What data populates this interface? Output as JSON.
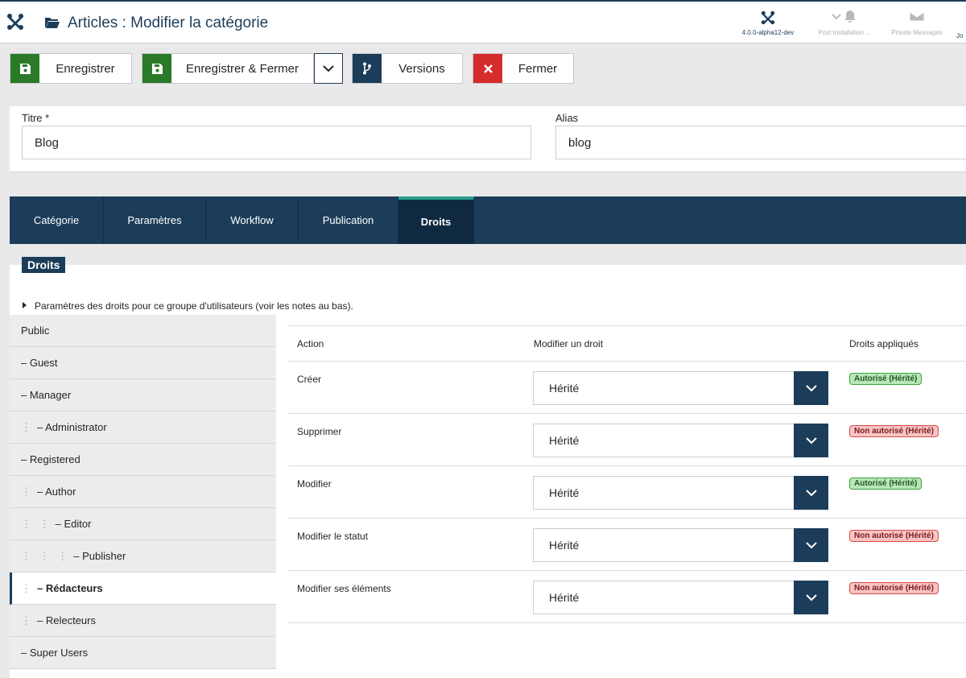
{
  "header": {
    "title": "Articles : Modifier la catégorie",
    "version": "4.0.0-alpha12-dev",
    "post_install": "Post Installation ...",
    "private_messages": "Private Messages",
    "user_initials": "Jo"
  },
  "toolbar": {
    "save": "Enregistrer",
    "save_close": "Enregistrer & Fermer",
    "versions": "Versions",
    "close": "Fermer"
  },
  "form": {
    "title_label": "Titre *",
    "title_value": "Blog",
    "alias_label": "Alias",
    "alias_value": "blog"
  },
  "tabs": [
    "Catégorie",
    "Paramètres",
    "Workflow",
    "Publication",
    "Droits"
  ],
  "active_tab": "Droits",
  "section": {
    "badge": "Droits",
    "summary": "Paramètres des droits pour ce groupe d'utilisateurs (voir les notes au bas)."
  },
  "groups": [
    {
      "dots": "",
      "label": "Public"
    },
    {
      "dots": "",
      "label": "– Guest"
    },
    {
      "dots": "",
      "label": "– Manager"
    },
    {
      "dots": "⋮",
      "label": "– Administrator"
    },
    {
      "dots": "",
      "label": "– Registered"
    },
    {
      "dots": "⋮",
      "label": "– Author"
    },
    {
      "dots": "⋮ ⋮",
      "label": "– Editor"
    },
    {
      "dots": "⋮ ⋮ ⋮",
      "label": "– Publisher"
    },
    {
      "dots": "⋮",
      "label": "– Rédacteurs"
    },
    {
      "dots": "⋮",
      "label": "– Relecteurs"
    },
    {
      "dots": "",
      "label": "– Super Users"
    }
  ],
  "active_group": "– Rédacteurs",
  "permissions": {
    "col_action": "Action",
    "col_modify": "Modifier un droit",
    "col_applied": "Droits appliqués",
    "rows": [
      {
        "action": "Créer",
        "value": "Hérité",
        "applied": "Autorisé (Hérité)",
        "status": "allowed"
      },
      {
        "action": "Supprimer",
        "value": "Hérité",
        "applied": "Non autorisé (Hérité)",
        "status": "denied"
      },
      {
        "action": "Modifier",
        "value": "Hérité",
        "applied": "Autorisé (Hérité)",
        "status": "allowed"
      },
      {
        "action": "Modifier le statut",
        "value": "Hérité",
        "applied": "Non autorisé (Hérité)",
        "status": "denied"
      },
      {
        "action": "Modifier ses éléments",
        "value": "Hérité",
        "applied": "Non autorisé (Hérité)",
        "status": "denied"
      }
    ]
  },
  "colors": {
    "navy": "#1c3d5a",
    "green": "#2a7a2a",
    "red": "#d42b2b",
    "accent": "#2a9d8f"
  },
  "icons": [
    "joomla-logo-icon",
    "folder-open-icon",
    "bell-icon",
    "envelope-icon",
    "save-icon",
    "chevron-down-icon",
    "branch-icon",
    "close-icon"
  ]
}
